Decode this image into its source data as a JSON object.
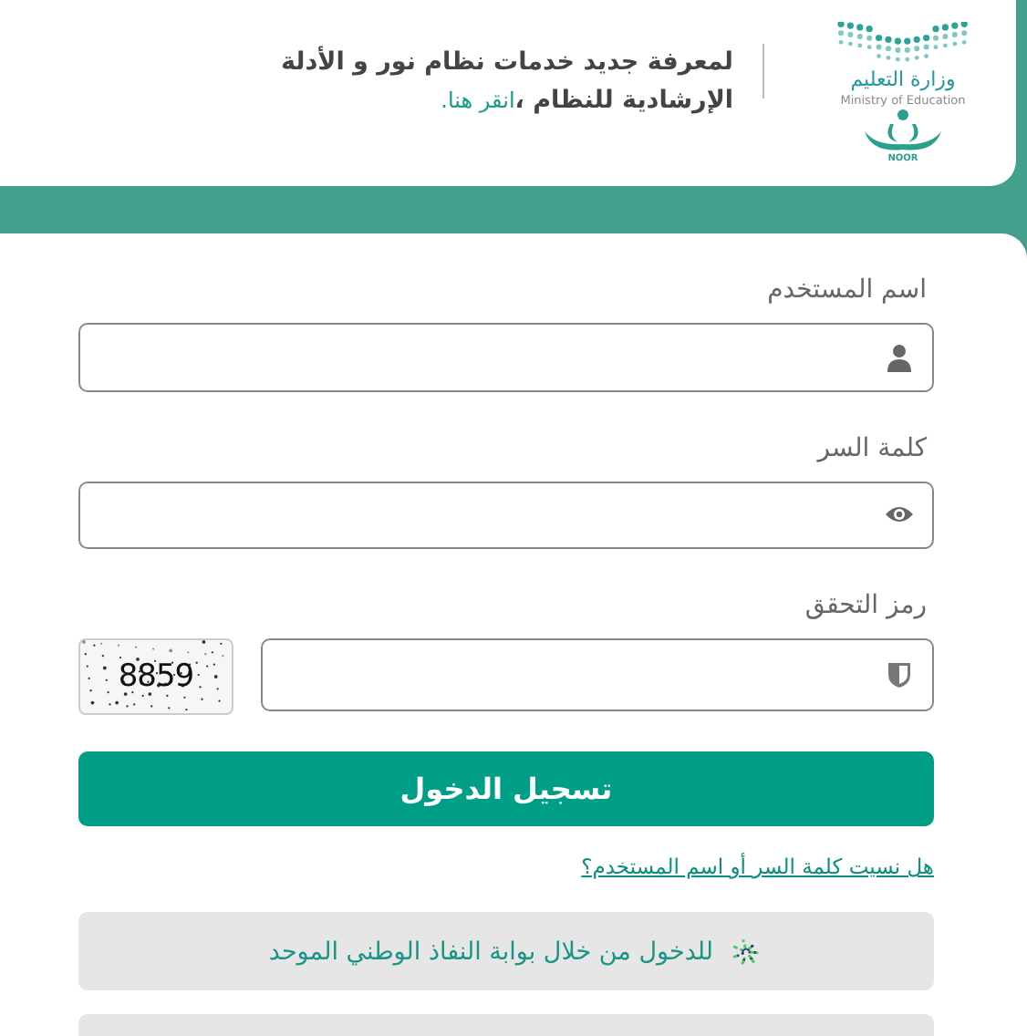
{
  "header": {
    "ministry_ar": "وزارة التعليم",
    "ministry_en": "Ministry of Education",
    "brand": "NOOR",
    "notice": "لمعرفة جديد خدمات نظام نور و الأدلة الإرشادية للنظام ،",
    "notice_link": "انقر هنا."
  },
  "form": {
    "username": {
      "label": "اسم المستخدم"
    },
    "password": {
      "label": "كلمة السر"
    },
    "captcha": {
      "label": "رمز التحقق",
      "code": "8859"
    },
    "login_button": "تسجيل الدخول",
    "forgot_link": "هل نسيت كلمة السر أو اسم المستخدم؟",
    "nafath_button": "للدخول من خلال بوابة النفاذ الوطني الموحد"
  }
}
